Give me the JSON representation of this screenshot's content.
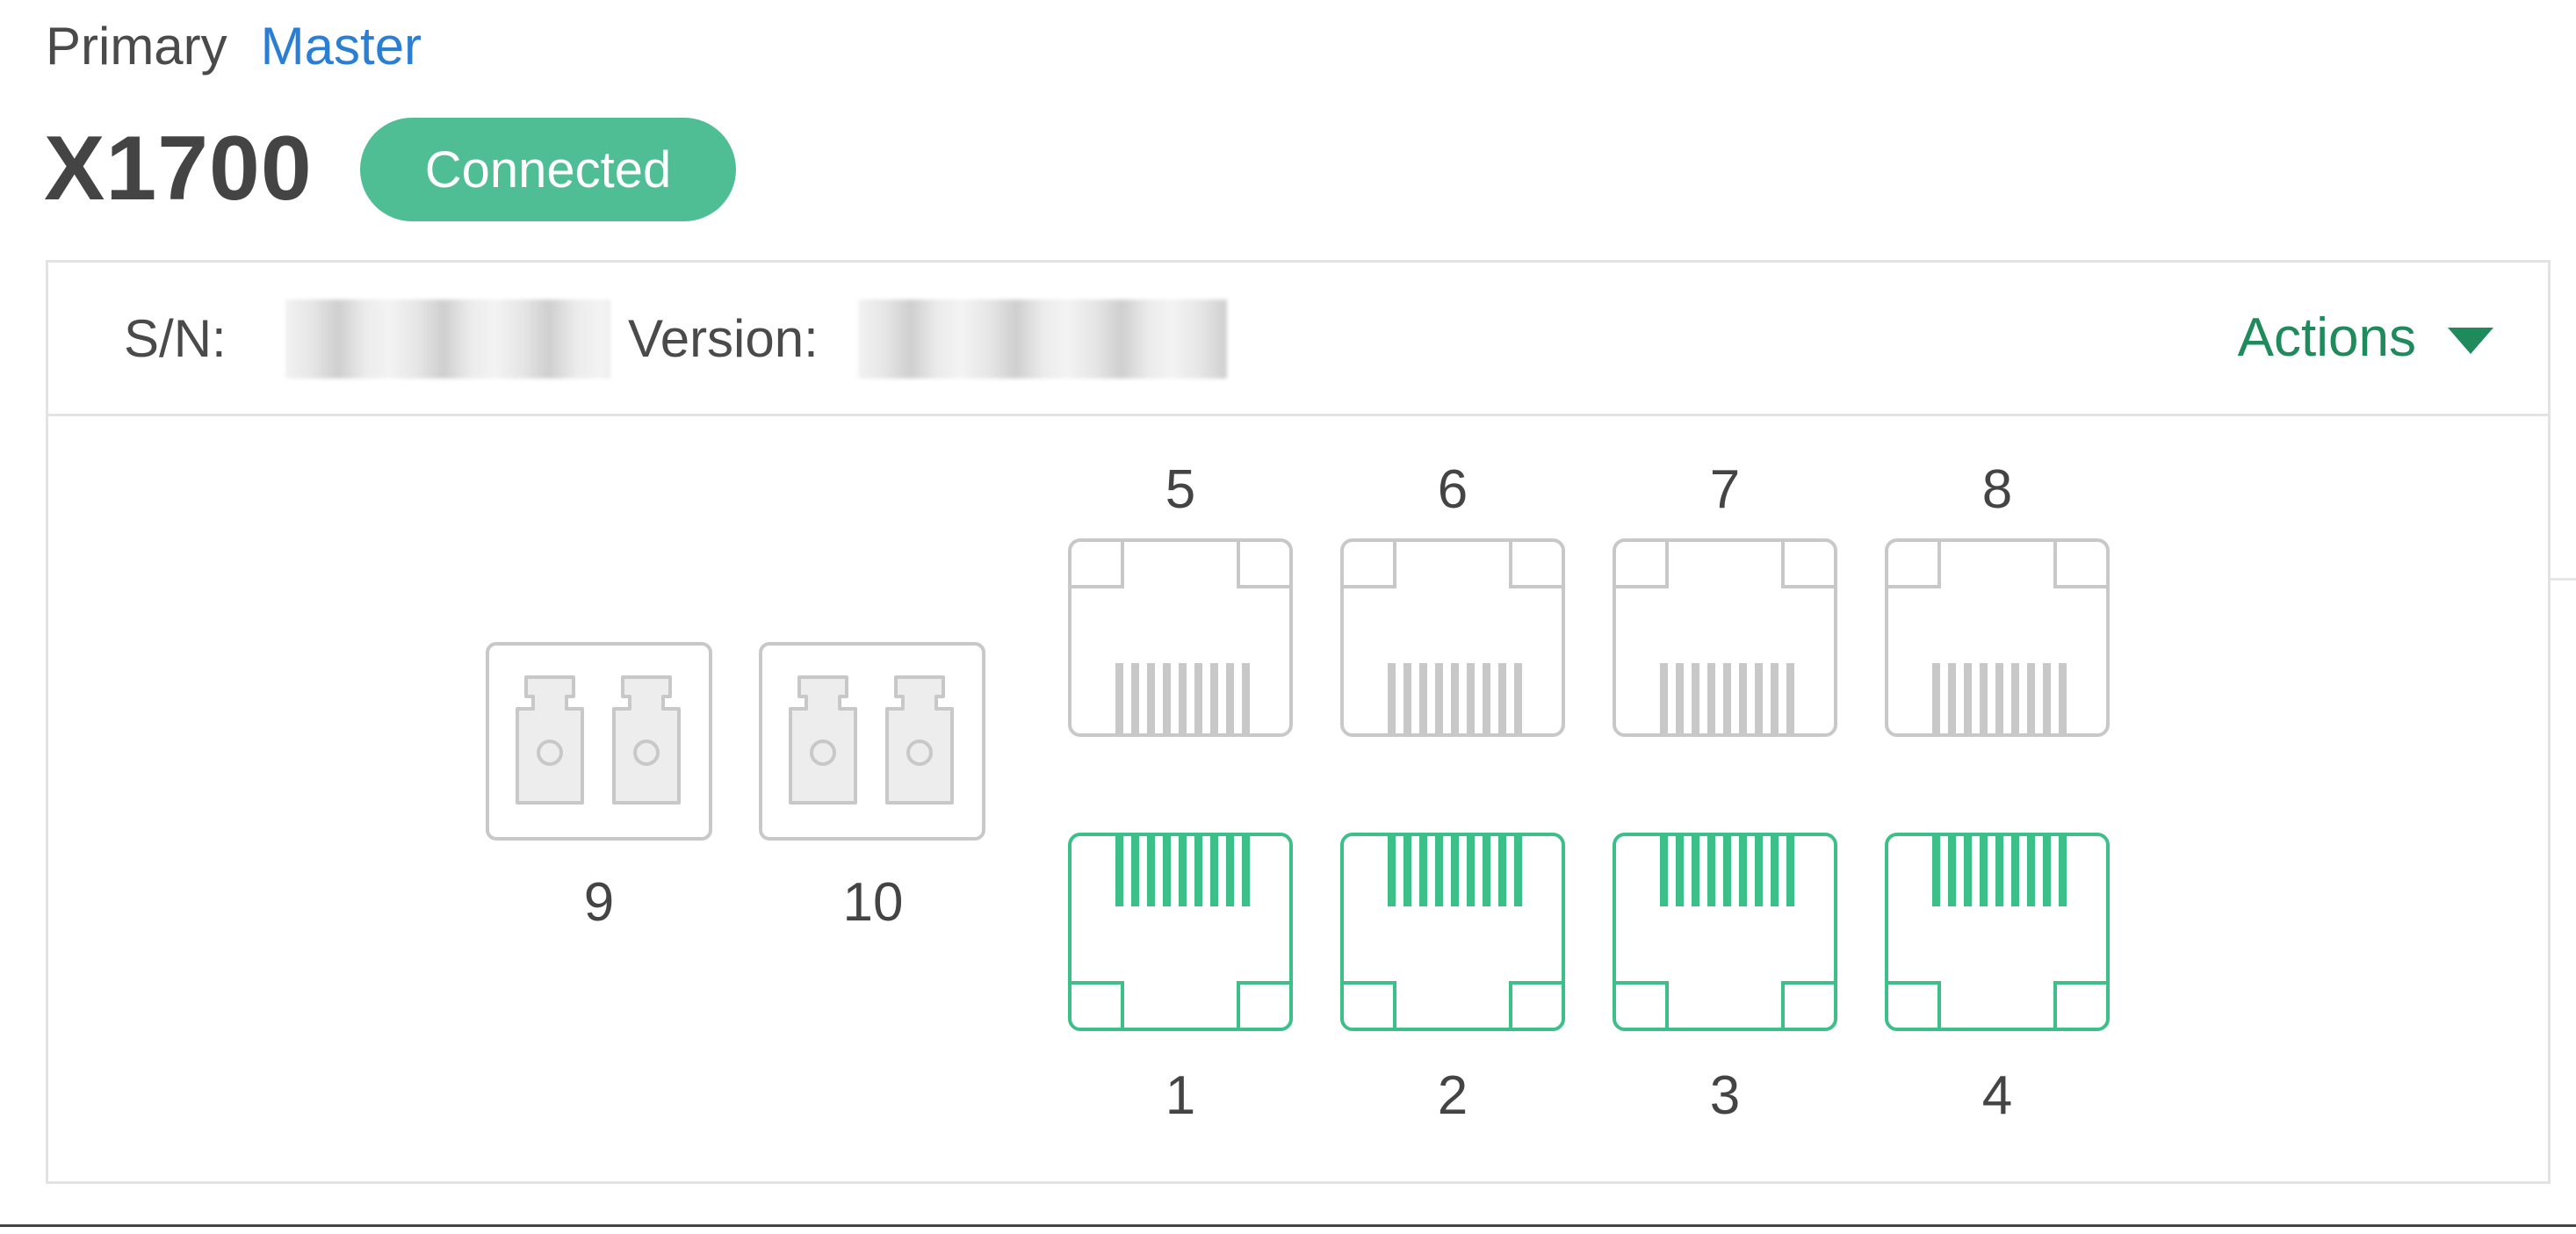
{
  "device": {
    "role_primary": "Primary",
    "role_master": "Master",
    "model": "X1700",
    "status": "Connected",
    "status_color": "#4fbe94"
  },
  "info": {
    "sn_label": "S/N:",
    "version_label": "Version:"
  },
  "actions": {
    "label": "Actions",
    "icon": "caret-down-icon"
  },
  "ports": {
    "sfp": [
      {
        "number": "9",
        "connected": false,
        "icon": "sfp-port-icon"
      },
      {
        "number": "10",
        "connected": false,
        "icon": "sfp-port-icon"
      }
    ],
    "top_row": [
      {
        "number": "5",
        "connected": false,
        "icon": "ethernet-port-icon"
      },
      {
        "number": "6",
        "connected": false,
        "icon": "ethernet-port-icon"
      },
      {
        "number": "7",
        "connected": false,
        "icon": "ethernet-port-icon"
      },
      {
        "number": "8",
        "connected": false,
        "icon": "ethernet-port-icon"
      }
    ],
    "bottom_row": [
      {
        "number": "1",
        "connected": true,
        "icon": "ethernet-port-icon"
      },
      {
        "number": "2",
        "connected": true,
        "icon": "ethernet-port-icon"
      },
      {
        "number": "3",
        "connected": true,
        "icon": "ethernet-port-icon"
      },
      {
        "number": "4",
        "connected": true,
        "icon": "ethernet-port-icon"
      }
    ],
    "colors": {
      "connected": "#3dbf8a",
      "disconnected": "#c8c8c8"
    }
  }
}
